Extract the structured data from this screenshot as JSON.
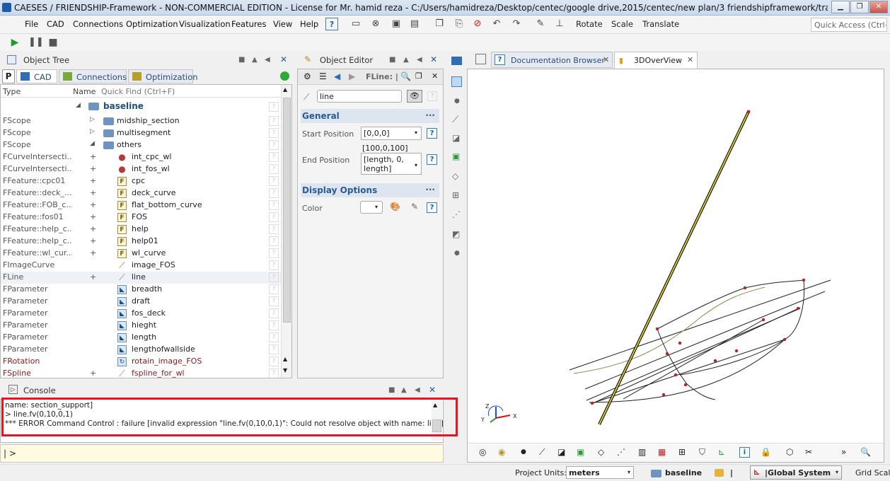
{
  "window": {
    "title": "CAESES / FRIENDSHIP-Framework - NON-COMMERCIAL EDITION - License for Mr. hamid reza - C:/Users/hamidreza/Desktop/centec/google drive,2015/centec/new plan/3 friendshipframework/tranining exercise/cur..."
  },
  "menu": [
    "File",
    "CAD",
    "Connections",
    "Optimization",
    "Visualization",
    "Features",
    "View",
    "Help"
  ],
  "toolbar": {
    "rotate": "Rotate",
    "scale": "Scale",
    "translate": "Translate",
    "quick_access": "Quick Access (Ctrl+Q)"
  },
  "object_tree": {
    "title": "Object Tree",
    "tabs": [
      "CAD",
      "Connections",
      "Optimization"
    ],
    "col_type": "Type",
    "col_name": "Name",
    "quick_find": "Quick Find (Ctrl+F)",
    "root": "baseline",
    "rows": [
      {
        "type": "FScope",
        "name": "midship_section",
        "kind": "folder",
        "exp": "▷"
      },
      {
        "type": "FScope",
        "name": "multisegment",
        "kind": "folder",
        "exp": "▷"
      },
      {
        "type": "FScope",
        "name": "others",
        "kind": "folder",
        "exp": "◢"
      },
      {
        "type": "FCurveIntersecti...",
        "name": "int_cpc_wl",
        "kind": "dot",
        "exp": "+"
      },
      {
        "type": "FCurveIntersecti...",
        "name": "int_fos_wl",
        "kind": "dot",
        "exp": "+"
      },
      {
        "type": "FFeature::cpc01",
        "name": "cpc",
        "kind": "f",
        "exp": "+"
      },
      {
        "type": "FFeature::deck_...",
        "name": "deck_curve",
        "kind": "f",
        "exp": "+"
      },
      {
        "type": "FFeature::FOB_c...",
        "name": "flat_bottom_curve",
        "kind": "f",
        "exp": "+"
      },
      {
        "type": "FFeature::fos01",
        "name": "FOS",
        "kind": "f",
        "exp": "+"
      },
      {
        "type": "FFeature::help_c...",
        "name": "help",
        "kind": "f",
        "exp": "+"
      },
      {
        "type": "FFeature::help_c...",
        "name": "help01",
        "kind": "f",
        "exp": "+"
      },
      {
        "type": "FFeature::wl_cur...",
        "name": "wl_curve",
        "kind": "f",
        "exp": "+"
      },
      {
        "type": "FImageCurve",
        "name": "image_FOS",
        "kind": "curve",
        "exp": ""
      },
      {
        "type": "FLine",
        "name": "line",
        "kind": "line",
        "exp": "+"
      },
      {
        "type": "FParameter",
        "name": "breadth",
        "kind": "p",
        "exp": ""
      },
      {
        "type": "FParameter",
        "name": "draft",
        "kind": "p",
        "exp": ""
      },
      {
        "type": "FParameter",
        "name": "fos_deck",
        "kind": "p",
        "exp": ""
      },
      {
        "type": "FParameter",
        "name": "hieght",
        "kind": "p",
        "exp": ""
      },
      {
        "type": "FParameter",
        "name": "length",
        "kind": "p",
        "exp": ""
      },
      {
        "type": "FParameter",
        "name": "lengthofwallside",
        "kind": "p",
        "exp": ""
      },
      {
        "type": "FRotation",
        "name": "rotain_image_FOS",
        "kind": "rot",
        "exp": ""
      },
      {
        "type": "FSpline",
        "name": "fspline_for_wl",
        "kind": "line",
        "exp": "+"
      }
    ]
  },
  "object_editor": {
    "title": "Object Editor",
    "header": "FLine: |",
    "name_value": "line",
    "general": "General",
    "start_label": "Start Position",
    "start_value": "[0,0,0]",
    "end_preview": "[100,0,100]",
    "end_label": "End Position",
    "end_value": "[length, 0, length]",
    "display": "Display Options",
    "color_label": "Color"
  },
  "tabs_right": {
    "doc": "Documentation Browser",
    "overview": "3DOverView"
  },
  "console": {
    "title": "Console",
    "lines": [
      "name: section_support]",
      "> line.fv(0,10,0,1)",
      "*** ERROR Command Control : failure [invalid expression \"line.fv(0,10,0,1)\": Could not resolve object with name: line]"
    ],
    "prompt": "| >"
  },
  "status": {
    "units_label": "Project Units:",
    "units_value": "meters",
    "scope": "baseline",
    "sep": "|",
    "coord": "|Global System",
    "grid": "Grid Scalin"
  }
}
